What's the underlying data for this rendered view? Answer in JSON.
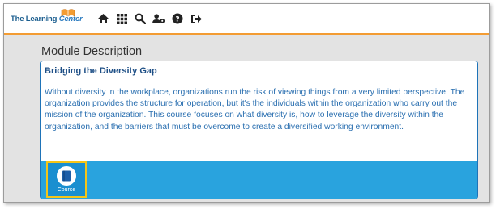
{
  "header": {
    "logo_text_main": "The Learning ",
    "logo_text_accent": "Center",
    "nav_icons": [
      "home-icon",
      "grid-icon",
      "search-icon",
      "user-settings-icon",
      "help-icon",
      "sign-out-icon"
    ],
    "accent_color": "#f39c33"
  },
  "module": {
    "heading": "Module Description",
    "course_title": "Bridging the Diversity Gap",
    "description": "Without diversity in the workplace, organizations run the risk of viewing things from a very limited perspective. The organization provides the structure for operation, but it's the individuals within the organization who carry out the mission of the organization. This course focuses on what diversity is, how to leverage the diversity within the organization, and the barriers that must be overcome to create a diversified working environment.",
    "course_button_label": "Course",
    "course_icon": "book-icon"
  },
  "colors": {
    "title_blue": "#1e4f86",
    "text_blue": "#2a6fb0",
    "footer_blue": "#29a3de",
    "highlight_yellow": "#f5c518"
  }
}
